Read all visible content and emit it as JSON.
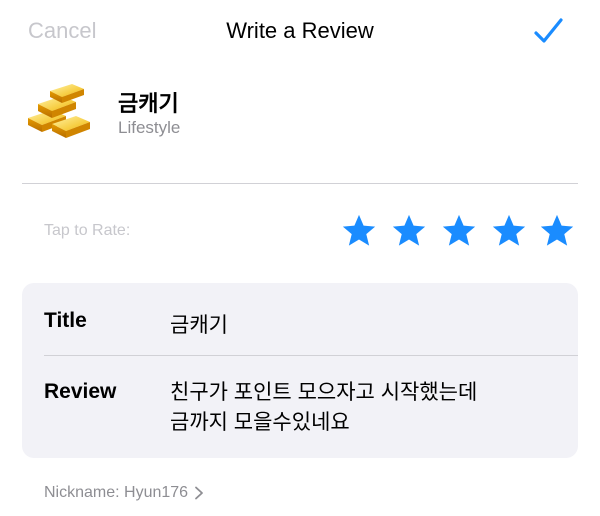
{
  "nav": {
    "cancel_label": "Cancel",
    "title": "Write a Review",
    "done_icon": "checkmark-icon"
  },
  "app": {
    "icon": "gold-bars-icon",
    "name": "금캐기",
    "category": "Lifestyle"
  },
  "rating": {
    "label": "Tap to Rate:",
    "stars_total": 5,
    "stars_selected": 5,
    "star_color": "#1a8cff"
  },
  "form": {
    "title_label": "Title",
    "title_value": "금캐기",
    "review_label": "Review",
    "review_lines": [
      "친구가 포인트 모으자고 시작했는데",
      "금까지 모을수있네요"
    ]
  },
  "nickname": {
    "text": "Nickname: Hyun176"
  },
  "colors": {
    "accent": "#1a8cff",
    "muted": "#c7c7cc",
    "secondary": "#8e8e93",
    "card_bg": "#f2f2f7"
  }
}
